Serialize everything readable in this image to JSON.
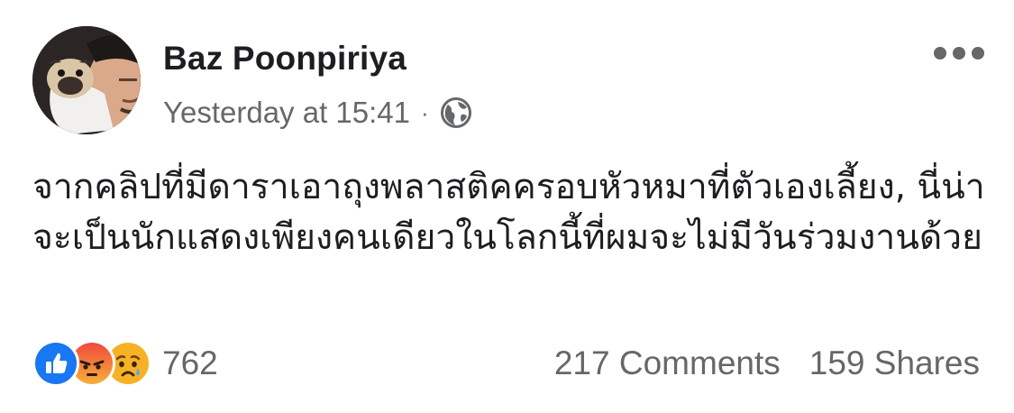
{
  "post": {
    "author": "Baz Poonpiriya",
    "timestamp": "Yesterday at 15:41",
    "separator": "·",
    "privacy_icon": "globe-icon",
    "more_icon": "more-options-icon",
    "text": "จากคลิปที่มีดาราเอาถุงพลาสติคครอบหัวหมาที่ตัวเองเลี้ยง, นี่น่าจะเป็นนักแสดงเพียงคนเดียวในโลกนี้ที่ผมจะไม่มีวันร่วมงานด้วย"
  },
  "footer": {
    "reaction_icons": [
      "like-icon",
      "angry-icon",
      "sad-icon"
    ],
    "reaction_count": "762",
    "comments": "217 Comments",
    "shares": "159 Shares"
  },
  "colors": {
    "like": "#1877f2",
    "angry": "#e9710f",
    "sad": "#f7b125",
    "secondary_text": "#65676b"
  }
}
